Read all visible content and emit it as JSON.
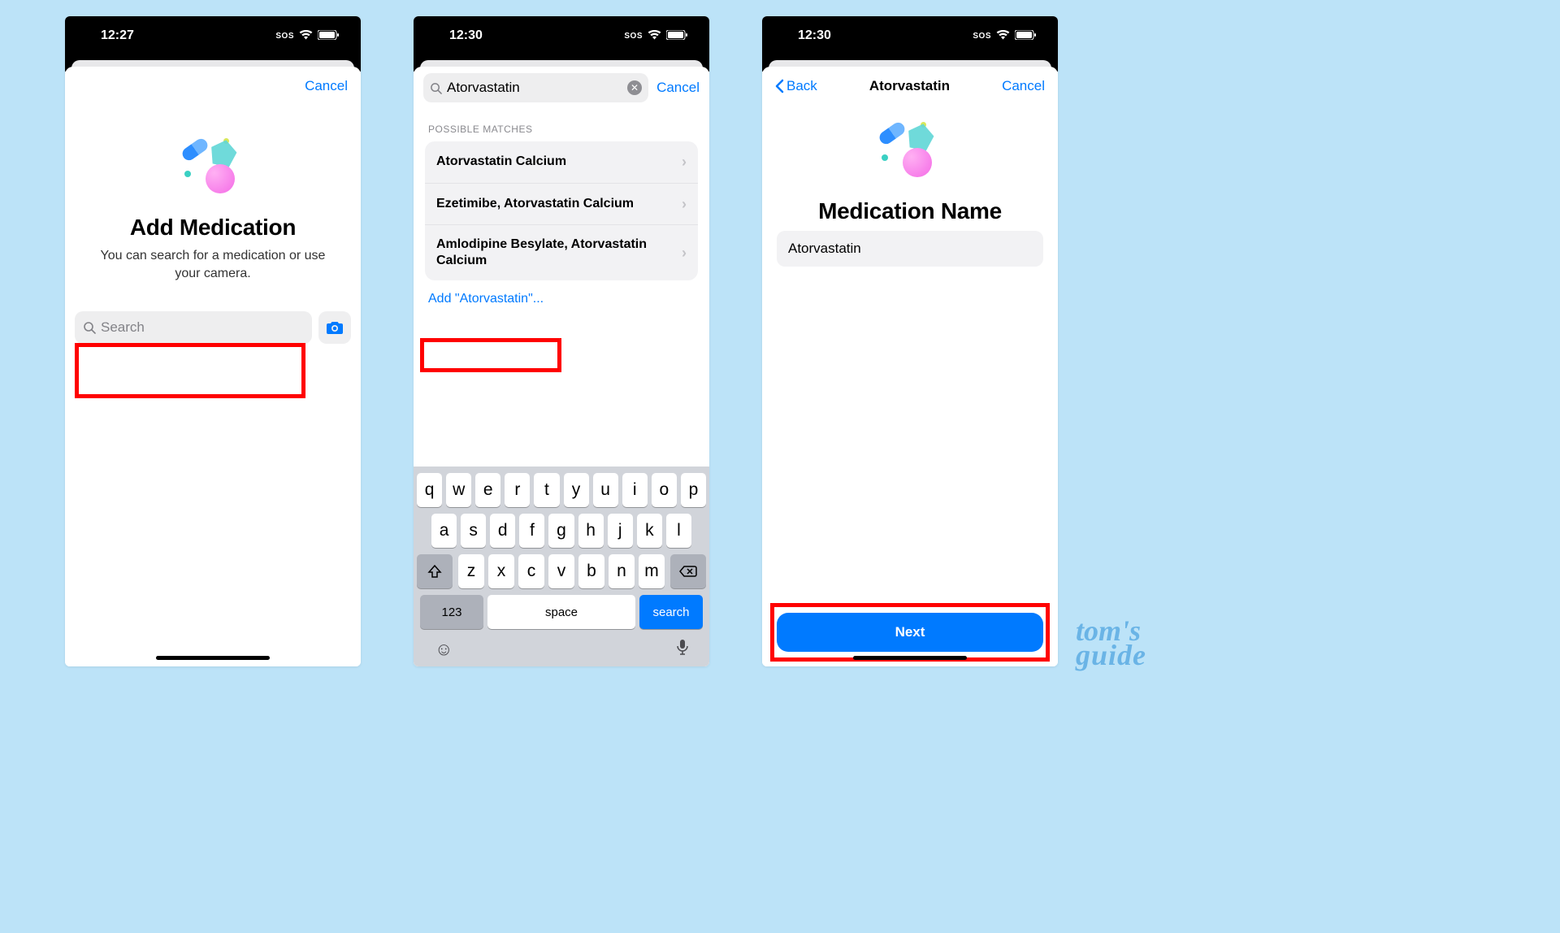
{
  "watermark": {
    "line1": "tom's",
    "line2": "guide"
  },
  "screen1": {
    "status": {
      "time": "12:27",
      "sos": "SOS"
    },
    "nav": {
      "cancel": "Cancel"
    },
    "title": "Add Medication",
    "subtitle": "You can search for a medication or use your camera.",
    "search_placeholder": "Search"
  },
  "screen2": {
    "status": {
      "time": "12:30",
      "sos": "SOS"
    },
    "nav": {
      "cancel": "Cancel"
    },
    "search_value": "Atorvastatin",
    "section_header": "POSSIBLE MATCHES",
    "matches": [
      "Atorvastatin Calcium",
      "Ezetimibe, Atorvastatin Calcium",
      "Amlodipine Besylate, Atorvastatin Calcium"
    ],
    "add_custom": "Add \"Atorvastatin\"...",
    "keyboard": {
      "row1": [
        "q",
        "w",
        "e",
        "r",
        "t",
        "y",
        "u",
        "i",
        "o",
        "p"
      ],
      "row2": [
        "a",
        "s",
        "d",
        "f",
        "g",
        "h",
        "j",
        "k",
        "l"
      ],
      "row3": [
        "z",
        "x",
        "c",
        "v",
        "b",
        "n",
        "m"
      ],
      "numbers": "123",
      "space": "space",
      "search": "search"
    }
  },
  "screen3": {
    "status": {
      "time": "12:30",
      "sos": "SOS"
    },
    "nav": {
      "back": "Back",
      "title": "Atorvastatin",
      "cancel": "Cancel"
    },
    "title": "Medication Name",
    "name_value": "Atorvastatin",
    "next": "Next"
  }
}
